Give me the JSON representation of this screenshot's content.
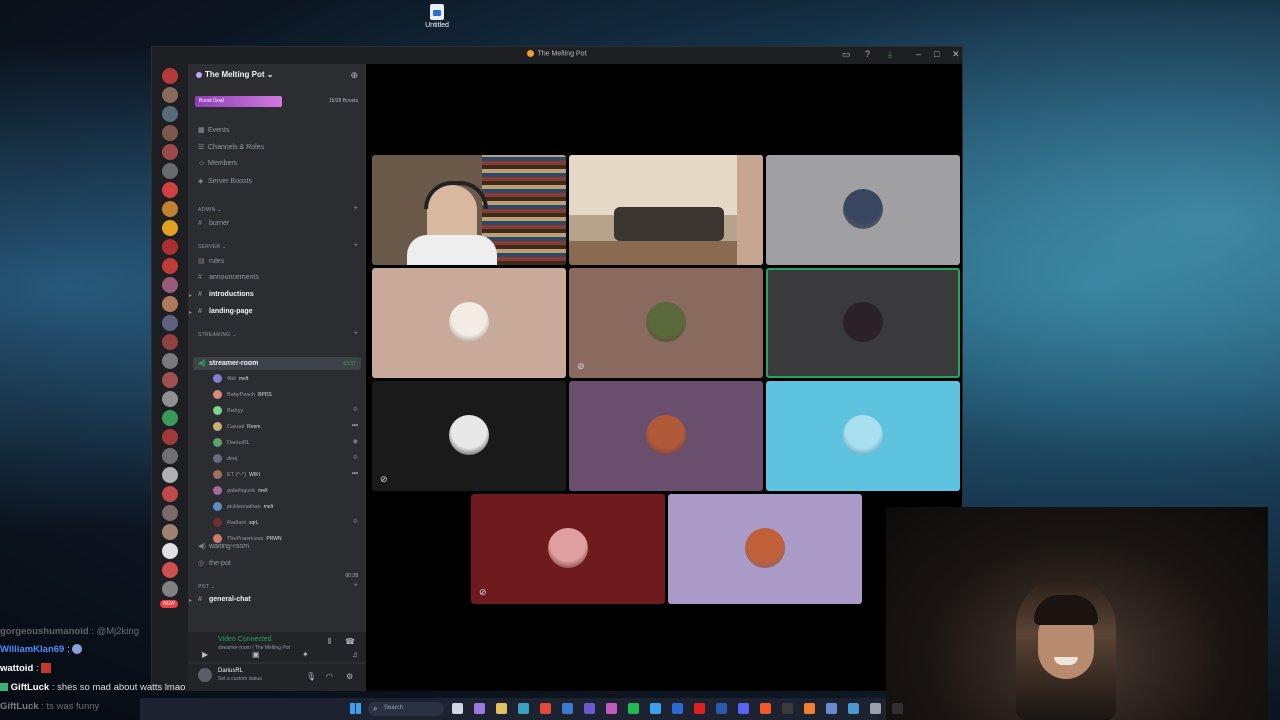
{
  "desktop": {
    "icon_label": "Untitled"
  },
  "window": {
    "title": "The Melting Pot"
  },
  "server": {
    "name": "The Melting Pot",
    "boost_goal": "Boost Goal",
    "boost_count": "15/28 Boosts"
  },
  "nav": [
    {
      "label": "Events",
      "icon": "calendar-icon"
    },
    {
      "label": "Channels & Roles",
      "icon": "list-icon"
    },
    {
      "label": "Members",
      "icon": "members-icon"
    },
    {
      "label": "Server Boosts",
      "icon": "boost-icon"
    }
  ],
  "categories": {
    "admin": "ADMIN",
    "server": "server",
    "streaming": "streaming",
    "pot": "pot"
  },
  "channels": {
    "burner": "burner",
    "rules": "rules",
    "announcements": "announcements",
    "introductions": "introductions",
    "landing_page": "landing-page",
    "streamer_room": "streamer-room",
    "streamer_timer": "63:37",
    "waiting_room": "waiting-room",
    "the_pot": "the-pot",
    "the_pot_counts": "00   28",
    "general_chat": "general-chat"
  },
  "members": [
    {
      "name": "4bit",
      "tag": "melt",
      "color": "#8a7bd6"
    },
    {
      "name": "BabyPeach",
      "tag": "BPDS",
      "color": "#d68a7b"
    },
    {
      "name": "Bishyy",
      "tag": "",
      "color": "#7bd68a"
    },
    {
      "name": "Casual",
      "tag": "Room",
      "color": "#c9b070"
    },
    {
      "name": "DariusRL",
      "tag": "",
      "color": "#5aa46a"
    },
    {
      "name": "deej",
      "tag": "",
      "color": "#6a6a80"
    },
    {
      "name": "ET (^-^)",
      "tag": "WIKI",
      "color": "#a07060"
    },
    {
      "name": "gabelsgunk",
      "tag": "melt",
      "color": "#a06aa0"
    },
    {
      "name": "picklesnathan",
      "tag": "melt",
      "color": "#5a90c0"
    },
    {
      "name": "Radiant",
      "tag": "sqrL",
      "color": "#703030"
    },
    {
      "name": "ThePrawncess",
      "tag": "PRWN",
      "color": "#d07a70"
    }
  ],
  "voice_panel": {
    "status": "Video Connected",
    "location": "streamer-room / The Melting Pot"
  },
  "user_panel": {
    "name": "DariusRL",
    "status": "Set a custom status"
  },
  "new_badge": "NEW",
  "tiles": [
    {
      "kind": "video-person",
      "bg": "#6b5a4a",
      "speaking": false,
      "muted": false
    },
    {
      "kind": "video-room",
      "bg": "#b7a28c",
      "speaking": false,
      "muted": false
    },
    {
      "kind": "avatar",
      "bg": "#a0a0a2",
      "avatar_color": "#3a4660",
      "speaking": false,
      "muted": false
    },
    {
      "kind": "avatar",
      "bg": "#c9a99a",
      "avatar_color": "#f2ece4",
      "speaking": false,
      "muted": false
    },
    {
      "kind": "avatar",
      "bg": "#8a6a5e",
      "avatar_color": "#5a6a3a",
      "speaking": false,
      "muted": true
    },
    {
      "kind": "avatar",
      "bg": "#3a3a3c",
      "avatar_color": "#2a2228",
      "speaking": true,
      "muted": false
    },
    {
      "kind": "avatar",
      "bg": "#1a1a1a",
      "avatar_color": "#e8e8e8",
      "speaking": false,
      "muted": true
    },
    {
      "kind": "avatar",
      "bg": "#6a4e6e",
      "avatar_color": "#b05a3a",
      "speaking": false,
      "muted": false
    },
    {
      "kind": "avatar",
      "bg": "#5ec3de",
      "avatar_color": "#a8e0f0",
      "speaking": false,
      "muted": false
    },
    {
      "kind": "avatar",
      "bg": "#6e1a1e",
      "avatar_color": "#e0a0a0",
      "speaking": false,
      "muted": true
    },
    {
      "kind": "avatar",
      "bg": "#a99ac7",
      "avatar_color": "#c0603a",
      "speaking": false,
      "muted": false
    }
  ],
  "chat": [
    {
      "user": "gorgeoushumanoid",
      "text": "@Mj2king",
      "user_color": "#c8c8c8",
      "faded": true
    },
    {
      "user": "WilliamKlan69",
      "text": "",
      "user_color": "#4f8bff",
      "faded": false
    },
    {
      "user": "wattoid",
      "text": "",
      "user_color": "#ffffff",
      "faded": false
    },
    {
      "user": "GiftLuck",
      "text": "shes so mad about watts lmao",
      "user_color": "#ffffff",
      "faded": false
    },
    {
      "user": "GiftLuck",
      "text": "ts was funny",
      "user_color": "#ffffff",
      "faded": true
    }
  ],
  "taskbar": {
    "search_placeholder": "Search"
  },
  "colors": {
    "discord_green": "#23a55a",
    "discord_bg": "#2b2d31",
    "rail_bg": "#1e1f22"
  }
}
